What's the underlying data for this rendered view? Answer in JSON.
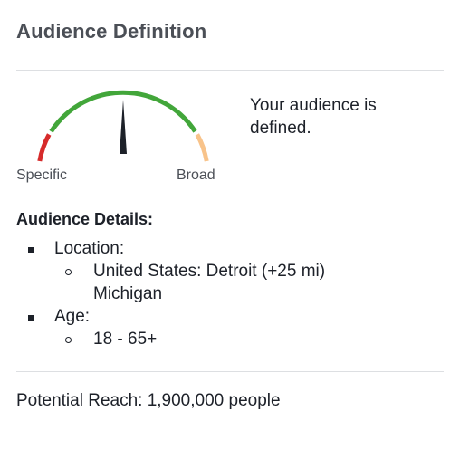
{
  "header": {
    "title": "Audience Definition"
  },
  "gauge": {
    "left_label": "Specific",
    "right_label": "Broad",
    "status": "Your audience is defined.",
    "level": 0.5,
    "colors": {
      "specific": "#d62b2b",
      "defined": "#42a63a",
      "broad": "#f8c38a",
      "needle": "#1d2129"
    }
  },
  "details": {
    "heading": "Audience Details:",
    "location_label": "Location:",
    "location_value": "United States: Detroit (+25 mi)",
    "location_region": "Michigan",
    "age_label": "Age:",
    "age_value": "18 - 65+"
  },
  "footer": {
    "reach": "Potential Reach: 1,900,000 people"
  }
}
